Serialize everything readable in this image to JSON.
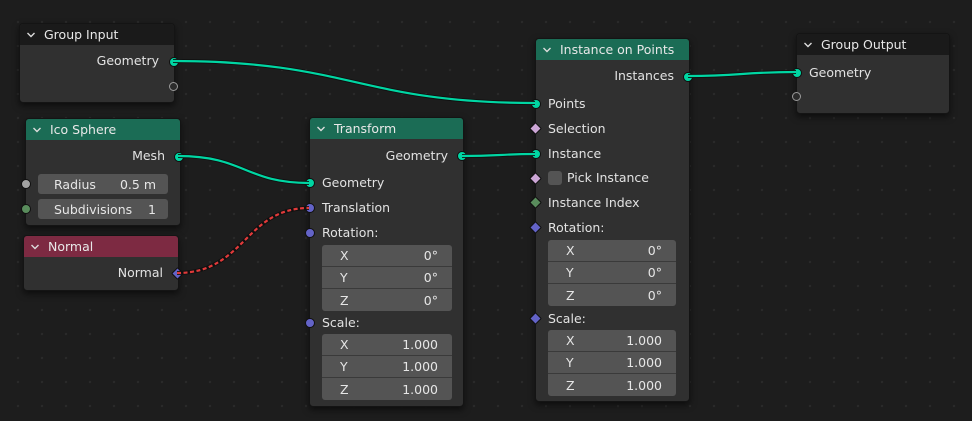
{
  "colors": {
    "geometry_socket": "#00d6a3",
    "vector_socket": "#6363c7",
    "float_socket": "#a1a1a1",
    "integer_socket": "#598c5c",
    "boolean_socket": "#cca6d6",
    "geometry_header": "#1b6c55",
    "input_header": "#7d2a42",
    "group_header": "#1a1a1a",
    "canvas": "#1d1d1d"
  },
  "group_input": {
    "title": "Group Input",
    "geometry": "Geometry"
  },
  "ico_sphere": {
    "title": "Ico Sphere",
    "mesh": "Mesh",
    "radius_label": "Radius",
    "radius_value": "0.5 m",
    "subdivisions_label": "Subdivisions",
    "subdivisions_value": "1"
  },
  "normal": {
    "title": "Normal",
    "output": "Normal"
  },
  "transform": {
    "title": "Transform",
    "out_geometry": "Geometry",
    "in_geometry": "Geometry",
    "translation": "Translation",
    "rotation": "Rotation:",
    "rotation_values": [
      {
        "axis": "X",
        "value": "0°"
      },
      {
        "axis": "Y",
        "value": "0°"
      },
      {
        "axis": "Z",
        "value": "0°"
      }
    ],
    "scale": "Scale:",
    "scale_values": [
      {
        "axis": "X",
        "value": "1.000"
      },
      {
        "axis": "Y",
        "value": "1.000"
      },
      {
        "axis": "Z",
        "value": "1.000"
      }
    ]
  },
  "instance_on_points": {
    "title": "Instance on Points",
    "instances": "Instances",
    "points": "Points",
    "selection": "Selection",
    "instance": "Instance",
    "pick_instance": "Pick Instance",
    "instance_index": "Instance Index",
    "rotation": "Rotation:",
    "rotation_values": [
      {
        "axis": "X",
        "value": "0°"
      },
      {
        "axis": "Y",
        "value": "0°"
      },
      {
        "axis": "Z",
        "value": "0°"
      }
    ],
    "scale": "Scale:",
    "scale_values": [
      {
        "axis": "X",
        "value": "1.000"
      },
      {
        "axis": "Y",
        "value": "1.000"
      },
      {
        "axis": "Z",
        "value": "1.000"
      }
    ]
  },
  "group_output": {
    "title": "Group Output",
    "geometry": "Geometry"
  }
}
